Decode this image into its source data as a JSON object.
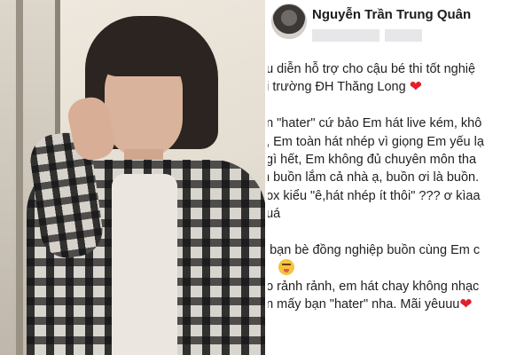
{
  "post": {
    "author": "Nguyễn Trần Trung Quân",
    "lines": [
      "ểu diễn hỗ trợ cho cậu bé thi tốt nghiệ",
      "ại trường ĐH Thăng Long",
      "",
      "an \"hater\" cứ bảo Em hát live kém, khô",
      "e, Em toàn hát nhép vì giọng Em yếu lạ",
      "t gì hết, Em không đủ chuyên môn tha",
      "m buồn lắm cả nhà ạ, buồn ơi là buồn.",
      "box kiểu \"ê,hát nhép ít thôi\" ??? ơ kìaa",
      "quá",
      "",
      "n bạn bè đồng nghiệp buồn cùng Em c",
      "",
      "ào rảnh rảnh, em hát chay không nhạc",
      "ồn mấy bạn \"hater\" nha. Mãi yêuuu"
    ],
    "heart_icon": "❤"
  }
}
